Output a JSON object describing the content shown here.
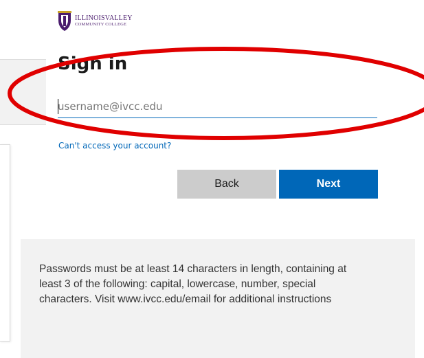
{
  "logo": {
    "line1": "ILLINOISVALLEY",
    "line2": "COMMUNITY COLLEGE",
    "icon": "ivcc-shield-logo-icon"
  },
  "signin": {
    "title": "Sign in",
    "username_placeholder": "username@ivcc.edu",
    "username_value": "",
    "cant_access_link": "Can't access your account?",
    "back_label": "Back",
    "next_label": "Next"
  },
  "info": {
    "text": "Passwords must be at least 14 characters in length, containing at least 3 of the following: capital, lowercase, number, special characters. Visit www.ivcc.edu/email for additional instructions"
  },
  "colors": {
    "accent": "#0067b8",
    "back_button": "#cccccc",
    "info_background": "#f2f2f2",
    "annotation_red": "#e00000",
    "logo_purple": "#4b1d6e"
  }
}
